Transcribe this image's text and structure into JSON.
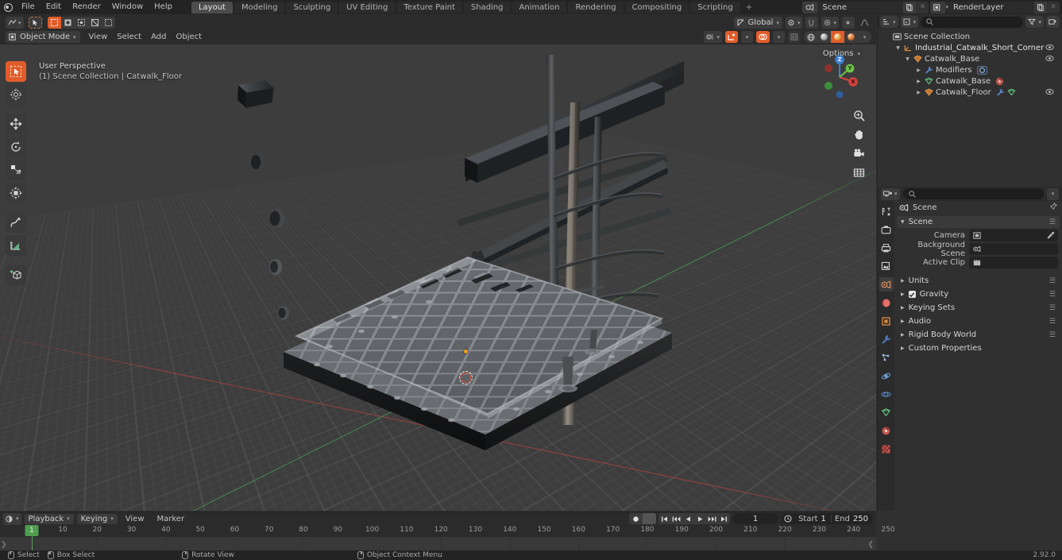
{
  "app": {
    "version": "2.92.0"
  },
  "topbar": {
    "menus": [
      "File",
      "Edit",
      "Render",
      "Window",
      "Help"
    ],
    "workspaces": [
      {
        "label": "Layout",
        "active": true
      },
      {
        "label": "Modeling",
        "active": false
      },
      {
        "label": "Sculpting",
        "active": false
      },
      {
        "label": "UV Editing",
        "active": false
      },
      {
        "label": "Texture Paint",
        "active": false
      },
      {
        "label": "Shading",
        "active": false
      },
      {
        "label": "Animation",
        "active": false
      },
      {
        "label": "Rendering",
        "active": false
      },
      {
        "label": "Compositing",
        "active": false
      },
      {
        "label": "Scripting",
        "active": false
      }
    ],
    "add_workspace_label": "+",
    "scene_name": "Scene",
    "view_layer_name": "RenderLayer"
  },
  "viewport": {
    "mode": "Object Mode",
    "menus": [
      "View",
      "Select",
      "Add",
      "Object"
    ],
    "transform_orientation": "Global",
    "options_label": "Options",
    "overlay_line1": "User Perspective",
    "overlay_line2": "(1) Scene Collection | Catwalk_Floor",
    "gizmo_axes": [
      {
        "label": "Z",
        "color": "#3b7fd4"
      },
      {
        "label": "Y",
        "color": "#6cc24a"
      },
      {
        "label": "X",
        "color": "#d1443e"
      }
    ],
    "nav_buttons": [
      "zoom-icon",
      "pan-icon",
      "camera-icon",
      "grid-icon"
    ],
    "tools": [
      {
        "name": "tweak-select-tool",
        "active": true
      },
      {
        "name": "cursor-tool",
        "active": false
      },
      {
        "name": "move-tool",
        "active": false
      },
      {
        "name": "rotate-tool",
        "active": false
      },
      {
        "name": "scale-tool",
        "active": false
      },
      {
        "name": "transform-tool",
        "active": false
      },
      {
        "name": "annotate-tool",
        "active": false
      },
      {
        "name": "measure-tool",
        "active": false
      },
      {
        "name": "add-cube-tool",
        "active": false
      }
    ]
  },
  "outliner": {
    "search_placeholder": "",
    "rows": [
      {
        "label": "Scene Collection",
        "icon": "collection-icon",
        "depth": 0,
        "expanded": true,
        "eye": false,
        "selected": false
      },
      {
        "label": "Industrial_Catwalk_Short_Corner",
        "icon": "empty-axes-icon",
        "depth": 1,
        "expanded": true,
        "eye": true,
        "selected": false
      },
      {
        "label": "Catwalk_Base",
        "icon": "mesh-object-icon",
        "depth": 2,
        "expanded": true,
        "eye": true,
        "selected": false
      },
      {
        "label": "Modifiers",
        "icon": "wrench-icon",
        "depth": 3,
        "expanded": false,
        "eye": false,
        "selected": false,
        "badge": "modifier-icon"
      },
      {
        "label": "Catwalk_Base",
        "icon": "mesh-data-icon",
        "depth": 3,
        "expanded": false,
        "eye": false,
        "selected": false,
        "badge": "material-icon"
      },
      {
        "label": "Catwalk_Floor",
        "icon": "mesh-object-icon",
        "depth": 3,
        "expanded": false,
        "eye": true,
        "selected": false,
        "badge": "wrench-mesh-icon"
      }
    ]
  },
  "properties": {
    "search_placeholder": "",
    "breadcrumb": "Scene",
    "tabs": [
      {
        "name": "tool-tab",
        "active": false
      },
      {
        "name": "render-tab",
        "active": false
      },
      {
        "name": "output-tab",
        "active": false
      },
      {
        "name": "view-layer-tab",
        "active": false
      },
      {
        "name": "scene-tab",
        "active": true
      },
      {
        "name": "world-tab",
        "active": false
      },
      {
        "name": "object-tab",
        "active": false
      },
      {
        "name": "modifier-tab",
        "active": false
      },
      {
        "name": "particles-tab",
        "active": false
      },
      {
        "name": "physics-tab",
        "active": false
      },
      {
        "name": "constraints-tab",
        "active": false
      },
      {
        "name": "data-tab",
        "active": false
      },
      {
        "name": "material-tab",
        "active": false
      },
      {
        "name": "texture-tab",
        "active": false
      }
    ],
    "scene_panel": {
      "title": "Scene",
      "fields": [
        {
          "label": "Camera",
          "value": "",
          "icon": "camera-icon"
        },
        {
          "label": "Background Scene",
          "value": "",
          "icon": "scene-icon"
        },
        {
          "label": "Active Clip",
          "value": "",
          "icon": "clip-icon"
        }
      ]
    },
    "closed_panels": [
      {
        "label": "Units",
        "checkbox": false
      },
      {
        "label": "Gravity",
        "checkbox": true
      },
      {
        "label": "Keying Sets",
        "checkbox": false
      },
      {
        "label": "Audio",
        "checkbox": false
      },
      {
        "label": "Rigid Body World",
        "checkbox": false
      },
      {
        "label": "Custom Properties",
        "checkbox": false
      }
    ]
  },
  "timeline": {
    "playback_label": "Playback",
    "keying_label": "Keying",
    "menus": [
      "View",
      "Marker"
    ],
    "current_frame": "1",
    "start_label": "Start",
    "start_value": "1",
    "end_label": "End",
    "end_value": "250",
    "ticks": [
      10,
      20,
      30,
      40,
      50,
      60,
      70,
      80,
      90,
      100,
      110,
      120,
      130,
      140,
      150,
      160,
      170,
      180,
      190,
      200,
      210,
      220,
      230,
      240,
      250
    ],
    "playhead_frame": "1"
  },
  "statusbar": {
    "items": [
      {
        "mouse": "left",
        "label": "Select"
      },
      {
        "mouse": "left-drag",
        "label": "Box Select"
      },
      {
        "mouse": "middle",
        "label": "Rotate View"
      },
      {
        "mouse": "right",
        "label": "Object Context Menu"
      }
    ],
    "version": "2.92.0"
  },
  "colors": {
    "accent": "#e05d2b",
    "axis_x": "#a84141",
    "axis_y": "#46964f",
    "axis_z": "#3b7fd4",
    "viewport_bg": "#3d3d3d",
    "panel_bg": "#303030",
    "header_bg": "#2b2b2b",
    "selected_row": "#3b4c60",
    "playhead": "#4e9e4e"
  }
}
